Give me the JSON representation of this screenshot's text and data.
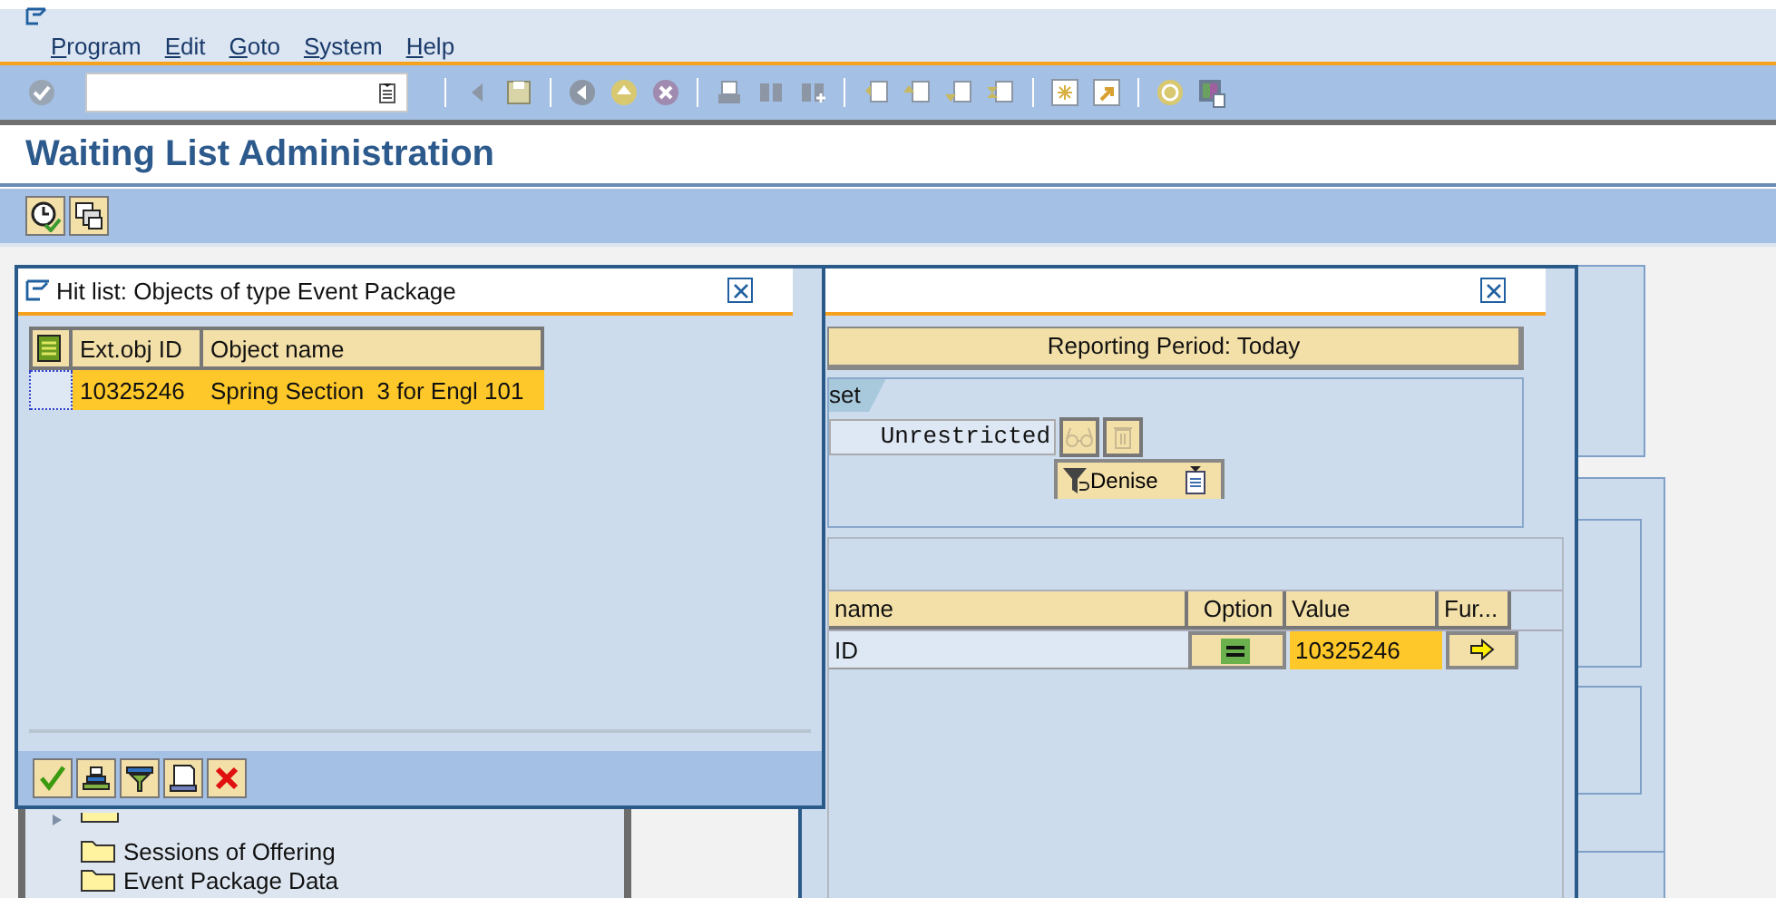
{
  "menu": [
    {
      "label": "Program"
    },
    {
      "label": "Edit"
    },
    {
      "label": "Goto"
    },
    {
      "label": "System"
    },
    {
      "label": "Help"
    }
  ],
  "title": "Waiting List Administration",
  "tree": [
    {
      "label": "Sessions of Offering"
    },
    {
      "label": "Event Package Data"
    }
  ],
  "selection_dialog": {
    "period": "Reporting Period: Today",
    "tab": "set",
    "field_value": "Unrestricted",
    "filter_button": "Denise",
    "columns": [
      "name",
      "Option",
      "Value",
      "Fur..."
    ],
    "rows": [
      {
        "name": "ID",
        "value": "10325246"
      }
    ]
  },
  "hit_list_dialog": {
    "title": "Hit list: Objects of type Event Package",
    "columns": [
      "Ext.obj ID",
      "Object name"
    ],
    "rows": [
      {
        "cells": [
          "10325246",
          "Spring Section  3 for Engl 101"
        ],
        "selected": true
      }
    ]
  }
}
